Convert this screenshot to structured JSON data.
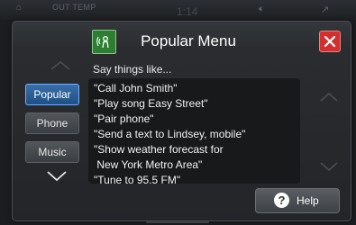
{
  "status_bar": {
    "outside_temp_label": "OUT TEMP",
    "time": "1:14"
  },
  "dialog": {
    "title": "Popular Menu",
    "voice_icon": "voice-command-icon",
    "close_icon": "close-icon",
    "close_color": "#d32f2f",
    "prompt": "Say things like...",
    "tabs": [
      {
        "label": "Popular",
        "active": true
      },
      {
        "label": "Phone",
        "active": false
      },
      {
        "label": "Music",
        "active": false
      }
    ],
    "phrases": [
      "\"Call John Smith\"",
      "\"Play song Easy Street\"",
      "\"Pair phone\"",
      "\"Send a text to Lindsey, mobile\"",
      "\"Show weather forecast for",
      " New York Metro Area\"",
      "\"Tune to 95.5 FM\""
    ],
    "help_label": "Help",
    "help_icon_glyph": "?",
    "accent_color": "#6fb0ff"
  }
}
